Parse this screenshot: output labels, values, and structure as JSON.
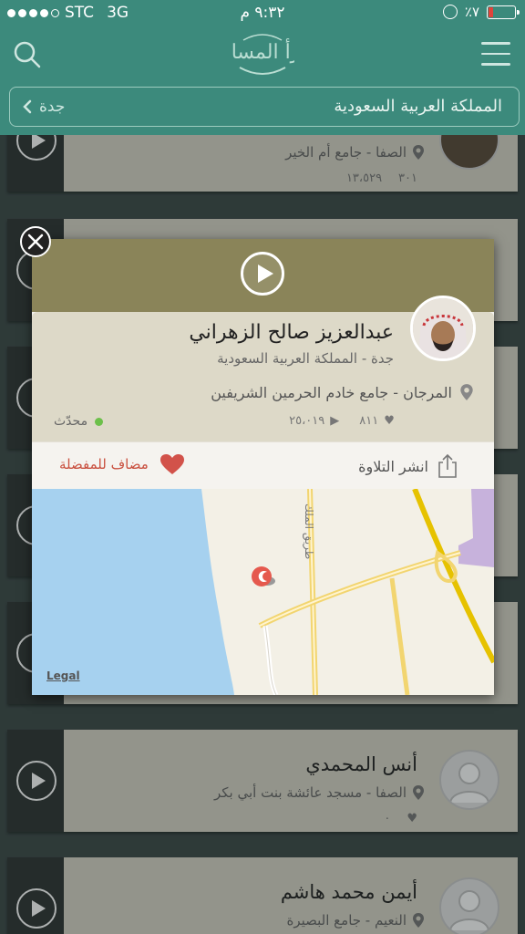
{
  "status_bar": {
    "carrier": "STC",
    "network": "3G",
    "time": "٩:٣٢ م",
    "battery": "٪٧"
  },
  "header": {
    "logo_label": "أقرأ المساجد",
    "location_country": "المملكة العربية السعودية",
    "location_city": "جدة"
  },
  "popup": {
    "name": "عبدالعزيز صالح الزهراني",
    "city": "جدة - المملكة العربية السعودية",
    "mosque": "المرجان - جامع خادم الحرمين الشريفين",
    "likes": "٨١١",
    "plays": "٢٥،٠١٩",
    "status": "محدّث",
    "share_label": "انشر التلاوة",
    "fav_label": "مضاف للمفضلة",
    "map_road_label": "طريق الملك",
    "map_legal": "Legal"
  },
  "list": {
    "items": [
      {
        "name": "",
        "place": "الصفا - جامع أم الخير",
        "likes": "٣٠١",
        "plays": "١٣،٥٢٩"
      },
      {
        "name": "أنس المحمدي",
        "place": "الصفا - مسجد عائشة بنت أبي بكر",
        "likes": "",
        "plays": "٠"
      },
      {
        "name": "أيمن محمد هاشم",
        "place": "النعيم - جامع البصيرة",
        "likes": "",
        "plays": ""
      }
    ]
  },
  "colors": {
    "header": "#3c8a7c",
    "popup_top": "#8a8459",
    "favorite": "#c9503f",
    "status_online": "#6cc04a"
  },
  "icons": [
    "search-icon",
    "menu-icon",
    "chevron-left-icon",
    "play-icon",
    "location-pin-icon",
    "heart-icon",
    "share-icon",
    "close-icon"
  ]
}
